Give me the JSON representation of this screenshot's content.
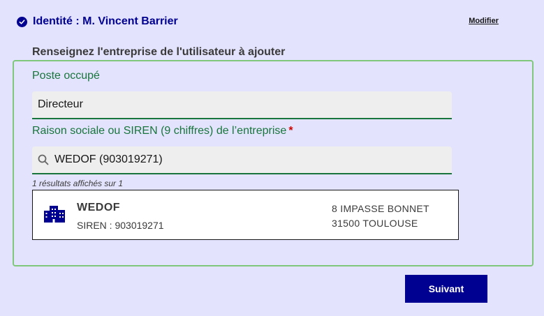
{
  "identity": {
    "title": "Identité : M. Vincent Barrier",
    "modify_label": "Modifier"
  },
  "section_heading": "Renseignez l'entreprise de l'utilisateur à ajouter",
  "form": {
    "position_label": "Poste occupé",
    "position_value": "Directeur",
    "company_label": "Raison sociale ou SIREN (9 chiffres) de l’entreprise",
    "required_marker": "*",
    "search_value": "WEDOF (903019271)",
    "results_count": "1 résultats affichés sur 1"
  },
  "results": [
    {
      "name": "WEDOF",
      "siren": "SIREN : 903019271",
      "address_line1": "8 IMPASSE BONNET",
      "address_line2": "31500 TOULOUSE"
    }
  ],
  "next_label": "Suivant",
  "colors": {
    "background": "#e3e3fd",
    "primary": "#000091",
    "success": "#18753c",
    "required": "#ce0500"
  },
  "icons": [
    "check-circle-icon",
    "search-icon",
    "building-icon"
  ]
}
